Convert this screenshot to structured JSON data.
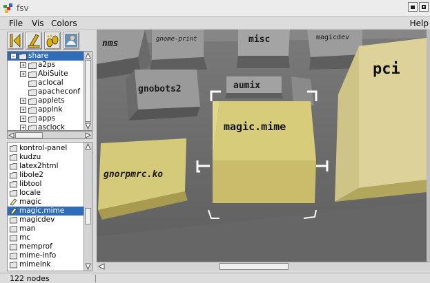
{
  "window": {
    "title": "fsv"
  },
  "menu": {
    "file": "File",
    "vis": "Vis",
    "colors": "Colors",
    "help": "Help"
  },
  "toolbar": {
    "buttons": [
      {
        "name": "back-to-root-icon"
      },
      {
        "name": "cd-up-icon"
      },
      {
        "name": "footprints-icon"
      },
      {
        "name": "bird-view-icon"
      }
    ]
  },
  "tree": {
    "items": [
      {
        "label": "share",
        "level": 0,
        "expander": "−",
        "selected": true
      },
      {
        "label": "a2ps",
        "level": 1,
        "expander": "+"
      },
      {
        "label": "AbiSuite",
        "level": 1,
        "expander": "+"
      },
      {
        "label": "aclocal",
        "level": 1,
        "expander": ""
      },
      {
        "label": "apacheconf",
        "level": 1,
        "expander": ""
      },
      {
        "label": "applets",
        "level": 1,
        "expander": "+"
      },
      {
        "label": "applnk",
        "level": 1,
        "expander": "+"
      },
      {
        "label": "apps",
        "level": 1,
        "expander": "+"
      },
      {
        "label": "asclock",
        "level": 1,
        "expander": "+"
      }
    ]
  },
  "list": {
    "items": [
      {
        "label": "kontrol-panel",
        "type": "folder"
      },
      {
        "label": "kudzu",
        "type": "folder"
      },
      {
        "label": "latex2html",
        "type": "folder"
      },
      {
        "label": "libole2",
        "type": "folder"
      },
      {
        "label": "libtool",
        "type": "folder"
      },
      {
        "label": "locale",
        "type": "folder"
      },
      {
        "label": "magic",
        "type": "file"
      },
      {
        "label": "magic.mime",
        "type": "file",
        "selected": true
      },
      {
        "label": "magicdev",
        "type": "folder"
      },
      {
        "label": "man",
        "type": "folder"
      },
      {
        "label": "mc",
        "type": "folder"
      },
      {
        "label": "memprof",
        "type": "folder"
      },
      {
        "label": "mime-info",
        "type": "folder"
      },
      {
        "label": "mimelnk",
        "type": "folder"
      }
    ]
  },
  "status": {
    "text": "122 nodes"
  },
  "scene": {
    "blocks": {
      "nms": "nms",
      "gnome_print": "gnome-print",
      "misc": "misc",
      "magicdev": "magicdev",
      "gnobots2": "gnobots2",
      "aumix": "aumix",
      "magic_mime": "magic.mime",
      "gnorpmrc": "gnorpmrc.ko",
      "pci": "pci"
    }
  },
  "colors": {
    "selection": "#2f6db8",
    "block_tan": "#d6cc7a",
    "block_gray": "#8c8c8c",
    "floor": "#6f6f6f"
  }
}
